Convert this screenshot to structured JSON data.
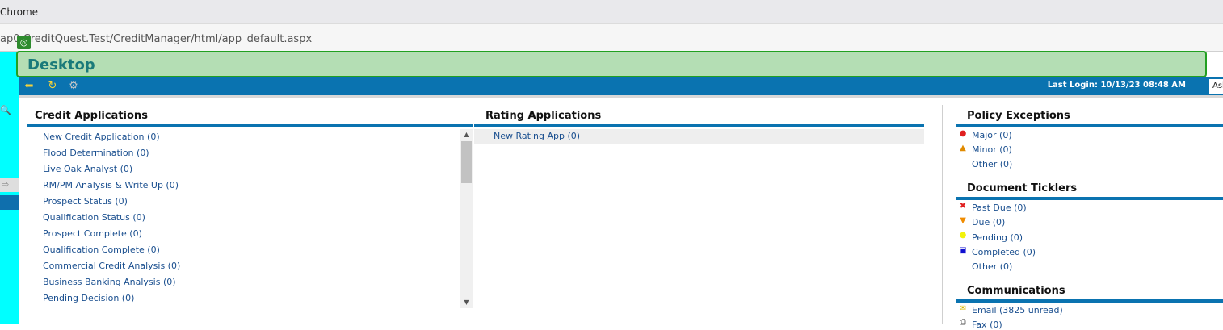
{
  "browser": {
    "title": "Chrome",
    "url": "ap0 CreditQuest.Test/CreditManager/html/app_default.aspx"
  },
  "page": {
    "title": "Desktop"
  },
  "toolbar": {
    "last_login": "Last Login: 10/13/23 08:48 AM",
    "user": "Ashley ."
  },
  "credit_applications": {
    "title": "Credit Applications",
    "items": [
      "New Credit Application (0)",
      "Flood Determination (0)",
      "Live Oak Analyst (0)",
      "RM/PM Analysis & Write Up (0)",
      "Prospect Status (0)",
      "Qualification Status (0)",
      "Prospect Complete (0)",
      "Qualification Complete (0)",
      "Commercial Credit Analysis (0)",
      "Business Banking Analysis (0)",
      "Pending Decision (0)"
    ]
  },
  "rating_applications": {
    "title": "Rating Applications",
    "items": [
      "New Rating App (0)"
    ]
  },
  "policy_exceptions": {
    "title": "Policy Exceptions",
    "items": [
      {
        "label": "Major (0)",
        "icon": "red-circle-icon"
      },
      {
        "label": "Minor (0)",
        "icon": "orange-triangle-icon"
      },
      {
        "label": "Other (0)",
        "icon": ""
      }
    ]
  },
  "document_ticklers": {
    "title": "Document Ticklers",
    "items": [
      {
        "label": "Past Due (0)",
        "icon": "red-x-icon"
      },
      {
        "label": "Due (0)",
        "icon": "orange-down-triangle-icon"
      },
      {
        "label": "Pending (0)",
        "icon": "yellow-circle-icon"
      },
      {
        "label": "Completed (0)",
        "icon": "blue-square-icon"
      },
      {
        "label": "Other (0)",
        "icon": ""
      }
    ]
  },
  "communications": {
    "title": "Communications",
    "items": [
      {
        "label": "Email (3825 unread)",
        "icon": "envelope-icon"
      },
      {
        "label": "Fax (0)",
        "icon": "fax-icon"
      }
    ]
  },
  "colors": {
    "accent": "#0a73b0",
    "banner": "#b4deb4",
    "strip": "#00ffff"
  }
}
